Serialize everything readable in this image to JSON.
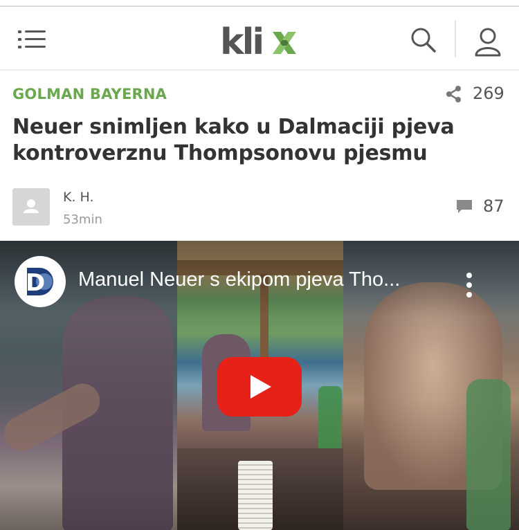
{
  "header": {
    "logo_text": "klix",
    "menu_icon": "hamburger-menu-icon",
    "search_icon": "search-icon",
    "user_icon": "user-icon",
    "brand_color": "#555555",
    "logo_x_color": "#6aa84f"
  },
  "article": {
    "kicker": "GOLMAN BAYERNA",
    "kicker_color": "#6aa84f",
    "share_count": "269",
    "title": "Neuer snimljen kako u Dalmaciji pjeva kontroverznu Thompsonovu pjesmu",
    "author": "K. H.",
    "time_ago": "53min",
    "comment_count": "87"
  },
  "video": {
    "title": "Manuel Neuer s ekipom pjeva Tho...",
    "channel_logo_letter": "D",
    "play_color": "#e62117"
  }
}
